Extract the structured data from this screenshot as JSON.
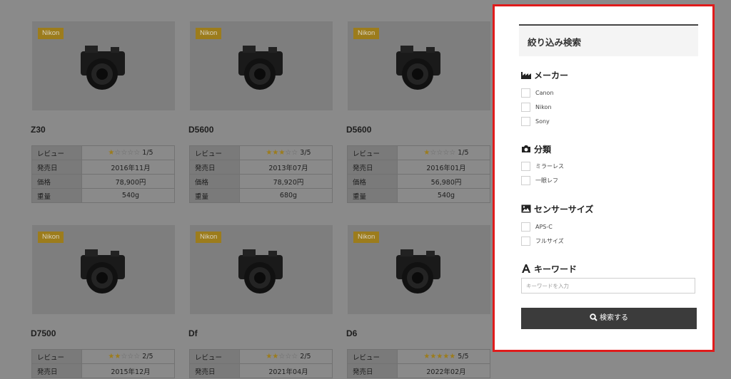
{
  "products": [
    {
      "brand": "Nikon",
      "name": "Z30",
      "rows": [
        {
          "k": "レビュー",
          "stars_on": 1,
          "v": "1/5"
        },
        {
          "k": "発売日",
          "v": "2016年11月"
        },
        {
          "k": "価格",
          "v": "78,900円"
        },
        {
          "k": "重量",
          "v": "540g"
        }
      ]
    },
    {
      "brand": "Nikon",
      "name": "D5600",
      "rows": [
        {
          "k": "レビュー",
          "stars_on": 3,
          "v": "3/5"
        },
        {
          "k": "発売日",
          "v": "2013年07月"
        },
        {
          "k": "価格",
          "v": "78,920円"
        },
        {
          "k": "重量",
          "v": "680g"
        }
      ]
    },
    {
      "brand": "Nikon",
      "name": "D5600",
      "rows": [
        {
          "k": "レビュー",
          "stars_on": 1,
          "v": "1/5"
        },
        {
          "k": "発売日",
          "v": "2016年01月"
        },
        {
          "k": "価格",
          "v": "56,980円"
        },
        {
          "k": "重量",
          "v": "540g"
        }
      ]
    },
    {
      "brand": "Nikon",
      "name": "D7500",
      "rows": [
        {
          "k": "レビュー",
          "stars_on": 2,
          "v": "2/5"
        },
        {
          "k": "発売日",
          "v": "2015年12月"
        }
      ]
    },
    {
      "brand": "Nikon",
      "name": "Df",
      "rows": [
        {
          "k": "レビュー",
          "stars_on": 2,
          "v": "2/5"
        },
        {
          "k": "発売日",
          "v": "2021年04月"
        }
      ]
    },
    {
      "brand": "Nikon",
      "name": "D6",
      "rows": [
        {
          "k": "レビュー",
          "stars_on": 5,
          "v": "5/5"
        },
        {
          "k": "発売日",
          "v": "2022年02月"
        }
      ]
    }
  ],
  "filter": {
    "title": "絞り込み検索",
    "maker": {
      "heading": "メーカー",
      "options": [
        "Canon",
        "Nikon",
        "Sony"
      ]
    },
    "category": {
      "heading": "分類",
      "options": [
        "ミラーレス",
        "一眼レフ"
      ]
    },
    "sensor": {
      "heading": "センサーサイズ",
      "options": [
        "APS-C",
        "フルサイズ"
      ]
    },
    "keyword": {
      "heading": "キーワード",
      "placeholder": "キーワードを入力"
    },
    "search_button": "検索する"
  },
  "colors": {
    "panel_border": "#e01b1b",
    "tag": "#9c7c1c",
    "button": "#3b3b3b"
  }
}
